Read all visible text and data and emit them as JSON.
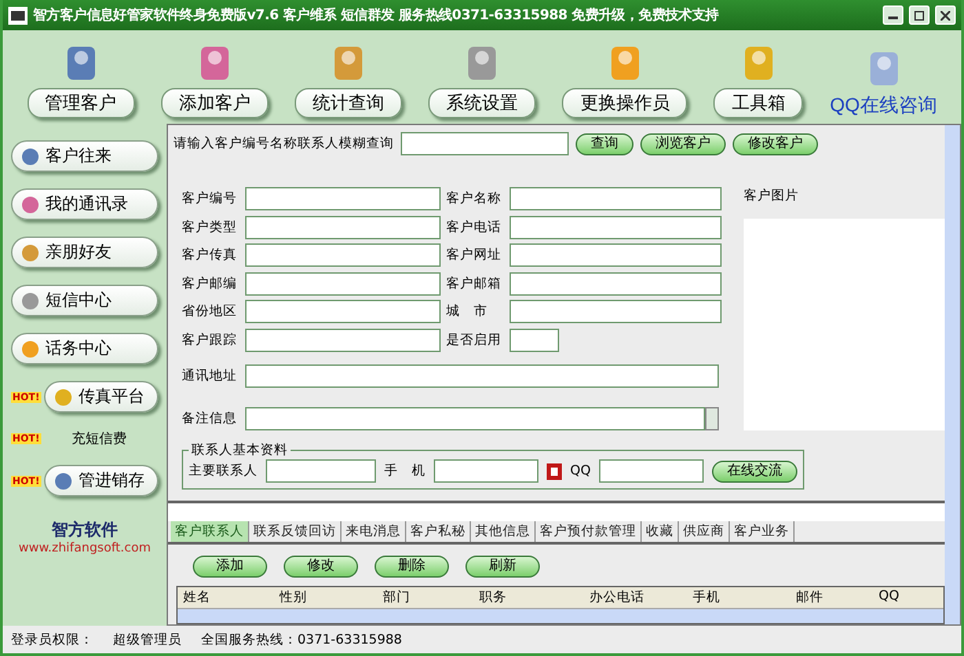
{
  "window": {
    "title": "智方客户信息好管家软件终身免费版v7.6 客户维系 短信群发  服务热线0371-63315988 免费升级，免费技术支持"
  },
  "toolbar": [
    {
      "label": "管理客户",
      "kind": "pill"
    },
    {
      "label": "添加客户",
      "kind": "pill"
    },
    {
      "label": "统计查询",
      "kind": "pill"
    },
    {
      "label": "系统设置",
      "kind": "pill"
    },
    {
      "label": "更换操作员",
      "kind": "pill"
    },
    {
      "label": "工具箱",
      "kind": "pill"
    },
    {
      "label": "QQ在线咨询",
      "kind": "link"
    }
  ],
  "sidebar": {
    "items": [
      {
        "label": "客户往来",
        "kind": "button"
      },
      {
        "label": "我的通讯录",
        "kind": "button"
      },
      {
        "label": "亲朋好友",
        "kind": "button"
      },
      {
        "label": "短信中心",
        "kind": "button"
      },
      {
        "label": "话务中心",
        "kind": "button"
      },
      {
        "label": "传真平台",
        "kind": "button",
        "hot": "HOT!"
      },
      {
        "label": "充短信费",
        "kind": "link",
        "hot": "HOT!"
      },
      {
        "label": "管进销存",
        "kind": "button",
        "hot": "HOT!"
      }
    ],
    "logo": {
      "name": "智方软件",
      "url": "www.zhifangsoft.com"
    }
  },
  "search": {
    "label": "请输入客户编号名称联系人模糊查询",
    "buttons": [
      "查询",
      "浏览客户",
      "修改客户"
    ]
  },
  "form": {
    "rows": [
      {
        "left": "客户编号",
        "right": "客户名称",
        "kind": "full"
      },
      {
        "left": "客户类型",
        "right": "客户电话",
        "kind": "full"
      },
      {
        "left": "客户传真",
        "right": "客户网址",
        "kind": "full"
      },
      {
        "left": "客户邮编",
        "right": "客户邮箱",
        "kind": "full"
      },
      {
        "left": "省份地区",
        "right": "城　市",
        "kind": "full"
      },
      {
        "left": "客户跟踪",
        "right": "是否启用",
        "kind": "short"
      }
    ],
    "address_label": "通讯地址",
    "remarks_label": "备注信息",
    "picture_label": "客户图片"
  },
  "contact": {
    "legend": "联系人基本资料",
    "main_label": "主要联系人",
    "mobile_label": "手　机",
    "qq_label": "QQ",
    "button": "在线交流"
  },
  "detail_tabs": [
    {
      "label": "客户联系人",
      "selected": true
    },
    {
      "label": "联系反馈回访",
      "selected": false
    },
    {
      "label": "来电消息",
      "selected": false
    },
    {
      "label": "客户私秘",
      "selected": false
    },
    {
      "label": "其他信息",
      "selected": false
    },
    {
      "label": "客户预付款管理",
      "selected": false
    },
    {
      "label": "收藏",
      "selected": false
    },
    {
      "label": "供应商",
      "selected": false
    },
    {
      "label": "客户业务",
      "selected": false
    }
  ],
  "actions": [
    "添加",
    "修改",
    "删除",
    "刷新"
  ],
  "table": {
    "columns": [
      "姓名",
      "性别",
      "部门",
      "职务",
      "办公电话",
      "手机",
      "邮件",
      "QQ"
    ]
  },
  "status_bar": [
    "登录员权限：",
    "超级管理员",
    "全国服务热线：0371-63315988"
  ]
}
